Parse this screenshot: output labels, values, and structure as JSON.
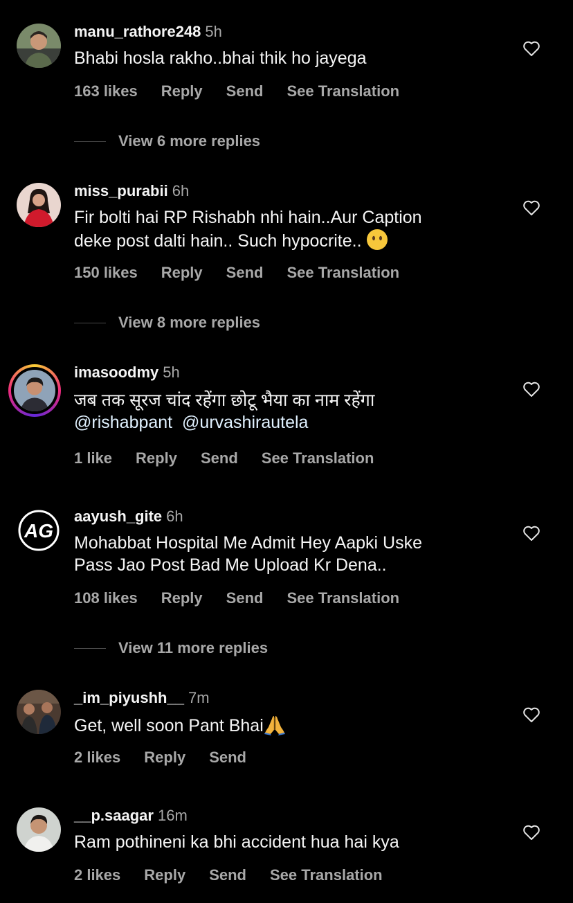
{
  "comments": [
    {
      "username": "manu_rathore248",
      "time": "5h",
      "text": "Bhabi hosla rakho..bhai thik ho jayega",
      "likes": "163 likes",
      "reply": "Reply",
      "send": "Send",
      "translate": "See Translation",
      "more_replies": "View 6 more replies"
    },
    {
      "username": "miss_purabii",
      "time": "6h",
      "text_line1": "Fir bolti hai RP Rishabh nhi hain..Aur Caption",
      "text_line2": "deke post dalti hain.. Such hypocrite..",
      "emoji": "face-without-mouth-emoji",
      "likes": "150 likes",
      "reply": "Reply",
      "send": "Send",
      "translate": "See Translation",
      "more_replies": "View 8 more replies"
    },
    {
      "username": "imasoodmy",
      "time": "5h",
      "text_line1": "जब तक सूरज चांद रहेंगा छोटू भैया का नाम रहेंगा",
      "mention1": "@rishabpant",
      "mention2": "@urvashirautela",
      "likes": "1 like",
      "reply": "Reply",
      "send": "Send",
      "translate": "See Translation"
    },
    {
      "username": "aayush_gite",
      "time": "6h",
      "avatar_text": "AG",
      "text_line1": "Mohabbat Hospital Me Admit Hey Aapki Uske",
      "text_line2": "Pass Jao Post Bad Me Upload Kr Dena..",
      "likes": "108 likes",
      "reply": "Reply",
      "send": "Send",
      "translate": "See Translation",
      "more_replies": "View 11 more replies"
    },
    {
      "username": "_im_piyushh__",
      "time": "7m",
      "text": "Get, well soon Pant Bhai",
      "emoji": "folded-hands-emoji",
      "likes": "2 likes",
      "reply": "Reply",
      "send": "Send"
    },
    {
      "username": "__p.saagar",
      "time": "16m",
      "text": "Ram pothineni ka bhi accident hua hai kya",
      "likes": "2 likes",
      "reply": "Reply",
      "send": "Send",
      "translate": "See Translation"
    }
  ],
  "colors": {
    "background": "#000000",
    "primary_text": "#f5f5f5",
    "secondary_text": "#a8a8a8",
    "mention": "#e0f1ff"
  }
}
